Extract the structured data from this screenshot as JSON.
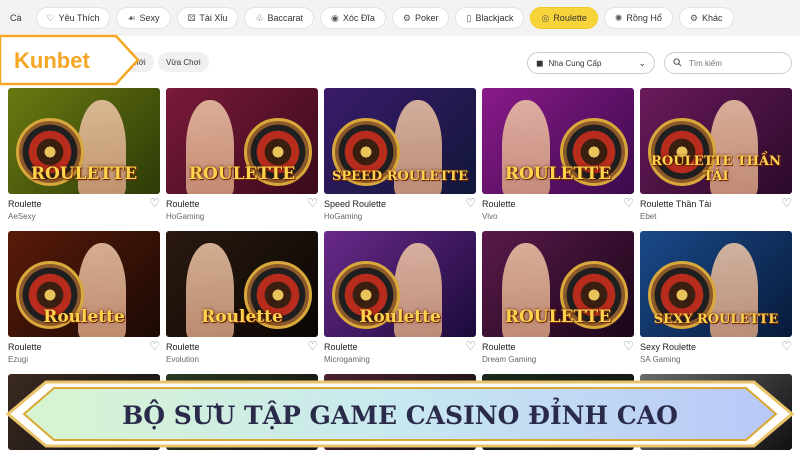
{
  "categories": [
    {
      "label": "Cà",
      "icon": "",
      "icon_name": "none",
      "active": false
    },
    {
      "label": "Yêu Thích",
      "icon": "♡",
      "icon_name": "heart-icon",
      "active": false
    },
    {
      "label": "Sexy",
      "icon": "☙",
      "icon_name": "car-icon",
      "active": false
    },
    {
      "label": "Tài Xỉu",
      "icon": "⚄",
      "icon_name": "dice-icon",
      "active": false
    },
    {
      "label": "Baccarat",
      "icon": "♧",
      "icon_name": "cards-icon",
      "active": false
    },
    {
      "label": "Xóc Đĩa",
      "icon": "◉",
      "icon_name": "dish-icon",
      "active": false
    },
    {
      "label": "Poker",
      "icon": "⚙",
      "icon_name": "chip-icon",
      "active": false
    },
    {
      "label": "Blackjack",
      "icon": "▯",
      "icon_name": "card-icon",
      "active": false
    },
    {
      "label": "Roulette",
      "icon": "◎",
      "icon_name": "roulette-icon",
      "active": true
    },
    {
      "label": "Rồng Hổ",
      "icon": "✺",
      "icon_name": "tiger-icon",
      "active": false
    },
    {
      "label": "Khác",
      "icon": "⚙",
      "icon_name": "gear-icon",
      "active": false
    }
  ],
  "filters": {
    "sub_new": "Mới",
    "sub_recent": "Vừa Chơi",
    "provider_select": "Nha Cung Cấp",
    "search_placeholder": "Tìm kiếm"
  },
  "logo": {
    "text": "Kunbet"
  },
  "games": [
    {
      "title": "Roulette",
      "provider": "AeSexy",
      "thumb_label": "ROULETTE",
      "bg1": "#6a7a10",
      "bg2": "#2c3a08"
    },
    {
      "title": "Roulette",
      "provider": "HoGaming",
      "thumb_label": "ROULETTE",
      "bg1": "#7a1a3a",
      "bg2": "#3a0a1c"
    },
    {
      "title": "Speed Roulette",
      "provider": "HoGaming",
      "thumb_label": "SPEED ROULETTE",
      "bg1": "#3a1a6a",
      "bg2": "#10183a"
    },
    {
      "title": "Roulette",
      "provider": "Vivo",
      "thumb_label": "ROULETTE",
      "bg1": "#8a1a8a",
      "bg2": "#3a0a4a"
    },
    {
      "title": "Roulette Thần Tài",
      "provider": "Ebet",
      "thumb_label": "ROULETTE THẦN TÀI",
      "bg1": "#6a1a5a",
      "bg2": "#2a0a2a"
    },
    {
      "title": "Roulette",
      "provider": "Ezugi",
      "thumb_label": "Roulette",
      "bg1": "#5a1a0a",
      "bg2": "#1a0a04"
    },
    {
      "title": "Roulette",
      "provider": "Evolution",
      "thumb_label": "Roulette",
      "bg1": "#2a1a10",
      "bg2": "#0a0604"
    },
    {
      "title": "Roulette",
      "provider": "Microgaming",
      "thumb_label": "Roulette",
      "bg1": "#6a2a8a",
      "bg2": "#1a0a3a"
    },
    {
      "title": "Roulette",
      "provider": "Dream Gaming",
      "thumb_label": "ROULETTE",
      "bg1": "#5a1a4a",
      "bg2": "#1a0618"
    },
    {
      "title": "Sexy Roulette",
      "provider": "SA Gaming",
      "thumb_label": "SEXY ROULETTE",
      "bg1": "#1a4a8a",
      "bg2": "#081a3a"
    }
  ],
  "banner": {
    "text": "BỘ SƯU TẬP GAME CASINO ĐỈNH CAO"
  },
  "colors": {
    "accent": "#f7d43a",
    "brand_orange": "#f5a623",
    "banner_text": "#2a2a4a"
  }
}
